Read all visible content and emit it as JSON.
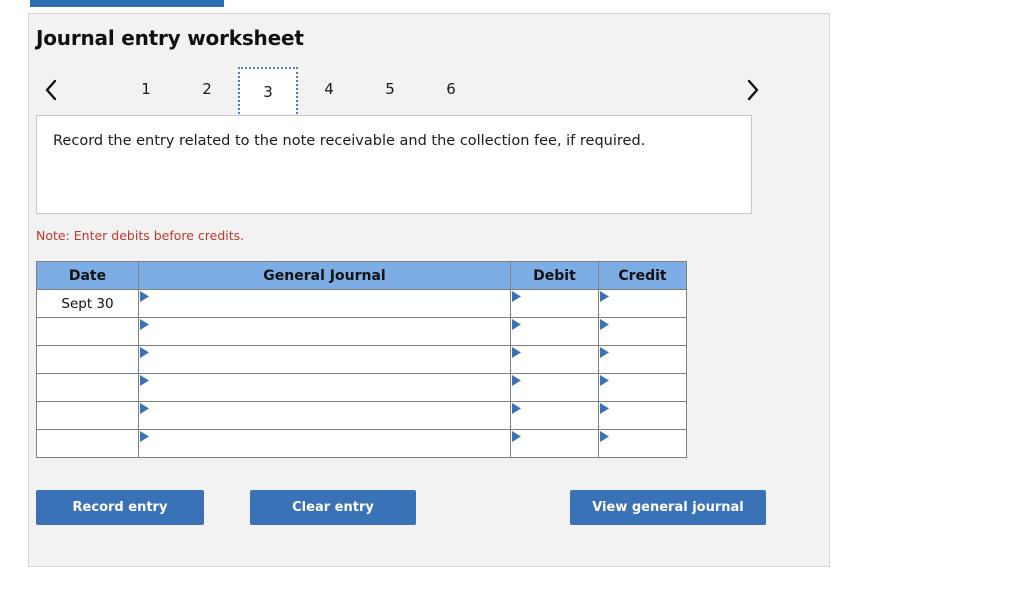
{
  "top_bar": {
    "present": true,
    "color": "#2a6db5"
  },
  "panel": {
    "title": "Journal entry worksheet",
    "background": "#f2f2f2"
  },
  "tabs": {
    "prev_icon": "chevron-left-icon",
    "next_icon": "chevron-right-icon",
    "items": [
      {
        "label": "1",
        "active": false
      },
      {
        "label": "2",
        "active": false
      },
      {
        "label": "3",
        "active": true
      },
      {
        "label": "4",
        "active": false
      },
      {
        "label": "5",
        "active": false
      },
      {
        "label": "6",
        "active": false
      }
    ],
    "active_index": 2
  },
  "instruction": {
    "text": "Record the entry related to the note receivable and the collection fee, if required."
  },
  "note": {
    "text": "Note: Enter debits before credits.",
    "color": "#c0392b"
  },
  "table": {
    "header_color": "#7cade5",
    "columns": [
      "Date",
      "General Journal",
      "Debit",
      "Credit"
    ],
    "rows": [
      {
        "date": "Sept 30",
        "general_journal": "",
        "debit": "",
        "credit": ""
      },
      {
        "date": "",
        "general_journal": "",
        "debit": "",
        "credit": ""
      },
      {
        "date": "",
        "general_journal": "",
        "debit": "",
        "credit": ""
      },
      {
        "date": "",
        "general_journal": "",
        "debit": "",
        "credit": ""
      },
      {
        "date": "",
        "general_journal": "",
        "debit": "",
        "credit": ""
      },
      {
        "date": "",
        "general_journal": "",
        "debit": "",
        "credit": ""
      }
    ]
  },
  "buttons": {
    "record": "Record entry",
    "clear": "Clear entry",
    "view": "View general journal",
    "color": "#3a72b8"
  }
}
